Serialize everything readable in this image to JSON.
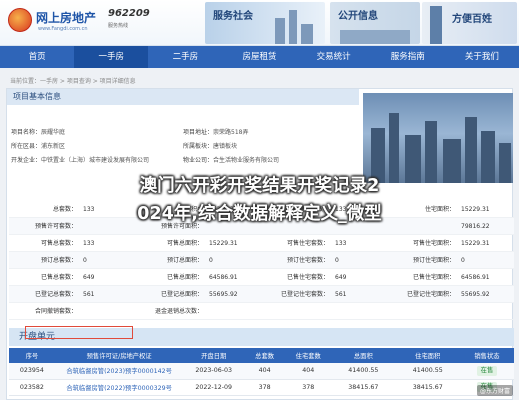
{
  "header": {
    "logo_text": "网上房地产",
    "logo_sub": "www.Fangdi.com.cn",
    "logo_num": "962209",
    "logo_num_sub": "服务热线",
    "banners": [
      "服务社会",
      "公开信息",
      "方便百姓"
    ]
  },
  "nav": {
    "items": [
      "首页",
      "一手房",
      "二手房",
      "房屋租赁",
      "交易统计",
      "服务指南",
      "关于我们"
    ],
    "active_index": 1
  },
  "breadcrumb": "当前位置：一手房 > 项目查询 > 项目详细信息",
  "project": {
    "section_title": "项目基本信息",
    "name_label": "项目名称：",
    "name": "辰耀华庭",
    "district_label": "所在区县：",
    "district": "浦东新区",
    "dev_label": "开发企业：",
    "dev": "中铁置业（上海）城市建设发展有限公司",
    "addr_label": "项目地址：",
    "addr": "崇荣路518弄",
    "plate_label": "所属板块：",
    "plate": "唐镇板块",
    "mgmt_label": "物业公司：",
    "mgmt": "合生活物业服务有限公司"
  },
  "watermark": {
    "line1": "澳门六开彩开奖结果开奖记录2",
    "line2": "024年,综合数据解释定义_微型"
  },
  "stats": {
    "rows": [
      [
        {
          "l": "总套数：",
          "v": "133"
        },
        {
          "l": "总面积：",
          "v": "15229.31"
        },
        {
          "l": "住宅套数：",
          "v": "133"
        },
        {
          "l": "住宅面积：",
          "v": "15229.31"
        }
      ],
      [
        {
          "l": "预售许可套数：",
          "v": ""
        },
        {
          "l": "预售许可面积：",
          "v": ""
        },
        {
          "l": "",
          "v": ""
        },
        {
          "l": "",
          "v": "79816.22"
        }
      ],
      [
        {
          "l": "可售总套数：",
          "v": "133"
        },
        {
          "l": "可售总面积：",
          "v": "15229.31"
        },
        {
          "l": "可售住宅套数：",
          "v": "133"
        },
        {
          "l": "可售住宅面积：",
          "v": "15229.31"
        }
      ],
      [
        {
          "l": "预订总套数：",
          "v": "0"
        },
        {
          "l": "预订总面积：",
          "v": "0"
        },
        {
          "l": "预订住宅套数：",
          "v": "0"
        },
        {
          "l": "预订住宅面积：",
          "v": "0"
        }
      ],
      [
        {
          "l": "已售总套数：",
          "v": "649"
        },
        {
          "l": "已售总面积：",
          "v": "64586.91"
        },
        {
          "l": "已售住宅套数：",
          "v": "649"
        },
        {
          "l": "已售住宅面积：",
          "v": "64586.91"
        }
      ],
      [
        {
          "l": "已登记总套数：",
          "v": "561"
        },
        {
          "l": "已登记总面积：",
          "v": "55695.92"
        },
        {
          "l": "已登记住宅套数：",
          "v": "561"
        },
        {
          "l": "已登记住宅面积：",
          "v": "55695.92"
        }
      ],
      [
        {
          "l": "合同撤销套数：",
          "v": ""
        },
        {
          "l": "退金退销总次数：",
          "v": ""
        },
        {
          "l": "",
          "v": ""
        },
        {
          "l": "",
          "v": ""
        }
      ]
    ]
  },
  "units": {
    "title": "开盘单元",
    "headers": [
      "序号",
      "预售许可证/房地产权证",
      "开盘日期",
      "总套数",
      "住宅套数",
      "总面积",
      "住宅面积",
      "销售状态"
    ],
    "rows": [
      [
        "023954",
        "合筑临督房管(2023)预字0000142号",
        "2023-06-03",
        "404",
        "404",
        "41400.55",
        "41400.55",
        "在售"
      ],
      [
        "023582",
        "合筑临督房管(2022)预字0000329号",
        "2022-12-09",
        "378",
        "378",
        "38415.67",
        "38415.67",
        "在售"
      ]
    ],
    "status_color": "#2a8a3f"
  },
  "corner_label": "@东方财富"
}
